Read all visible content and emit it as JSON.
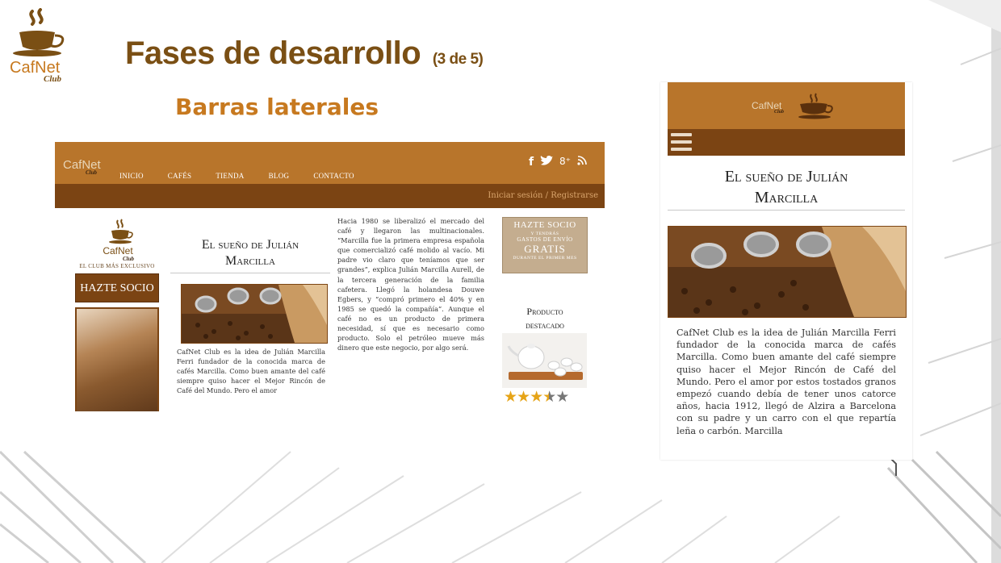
{
  "slide": {
    "title": "Fases de desarrollo",
    "title_suffix": "(3 de 5)",
    "subtitle": "Barras laterales",
    "logo": {
      "brand": "CafNet",
      "club": "Club",
      "icon": "coffee-cup-logo"
    }
  },
  "desktop": {
    "brand": "CafNet",
    "brand_club": "Club",
    "menu": [
      "Inicio",
      "Cafés",
      "Tienda",
      "Blog",
      "Contacto"
    ],
    "social_icons": [
      "facebook-icon",
      "twitter-icon",
      "google-plus-icon",
      "rss-icon"
    ],
    "social_glyphs": {
      "facebook": "f",
      "twitter": "🐦",
      "google": "8⁺",
      "rss": "⟆"
    },
    "login": "Iniciar sesión",
    "separator": "/",
    "register": "Registrarse",
    "left_sidebar": {
      "brand": "CafNet",
      "club": "Club",
      "club_text": "EL CLUB MÁS EXCLUSIVO",
      "cta": "HAZTE SOCIO"
    },
    "article_title_line1": "El sueño de Julián",
    "article_title_line2": "Marcilla",
    "article_text": "CafNet Club es la idea de Julián Marcilla Ferri fundador de la conocida marca de cafés Marcilla. Como buen amante del café siempre quiso hacer el Mejor Rincón de Café del Mundo. Pero el amor",
    "right_text": "Hacia 1980 se liberalizó el mercado del café y llegaron las multinacionales. “Marcilla fue la primera empresa española que comercializó café molido al vacío. Mi padre vio claro que teníamos que ser grandes”, explica Julián Marcilla Aurell, de la tercera generación de la familia cafetera. Llegó la holandesa Douwe Egbers, y “compró primero el 40% y en 1985 se quedó la compañía”. Aunque el café no es un producto de primera necesidad, sí que es necesario como producto. Solo el petróleo mueve más dinero que este negocio, por algo será.",
    "promo": {
      "line1": "HAZTE SOCIO",
      "line2": "Y TENDRÁS",
      "line3": "GASTOS DE ENVÍO",
      "line4": "GRATIS",
      "line5": "DURANTE EL PRIMER MES"
    },
    "featured_title_line1": "Producto",
    "featured_title_line2": "destacado",
    "rating": 3.5,
    "rating_max": 5
  },
  "mobile": {
    "brand": "CafNet",
    "brand_club": "Club",
    "title_line1": "El sueño de Julián",
    "title_line2": "Marcilla",
    "text": "CafNet Club es la idea de Julián Marcilla Ferri fundador de la conocida marca de cafés Marcilla. Como buen amante del café siempre quiso hacer el Mejor Rincón de Café del Mundo. Pero el amor por estos tostados granos empezó cuando debía de tener unos catorce años, hacia 1912, llegó de Alzira a Barcelona con su padre y un carro con el que repartía leña o carbón. Marcilla"
  },
  "colors": {
    "brand_primary": "#b8752b",
    "brand_dark": "#7b4413",
    "title_brown": "#7a4f14",
    "subtitle_orange": "#c7791f",
    "star": "#e6a417"
  }
}
